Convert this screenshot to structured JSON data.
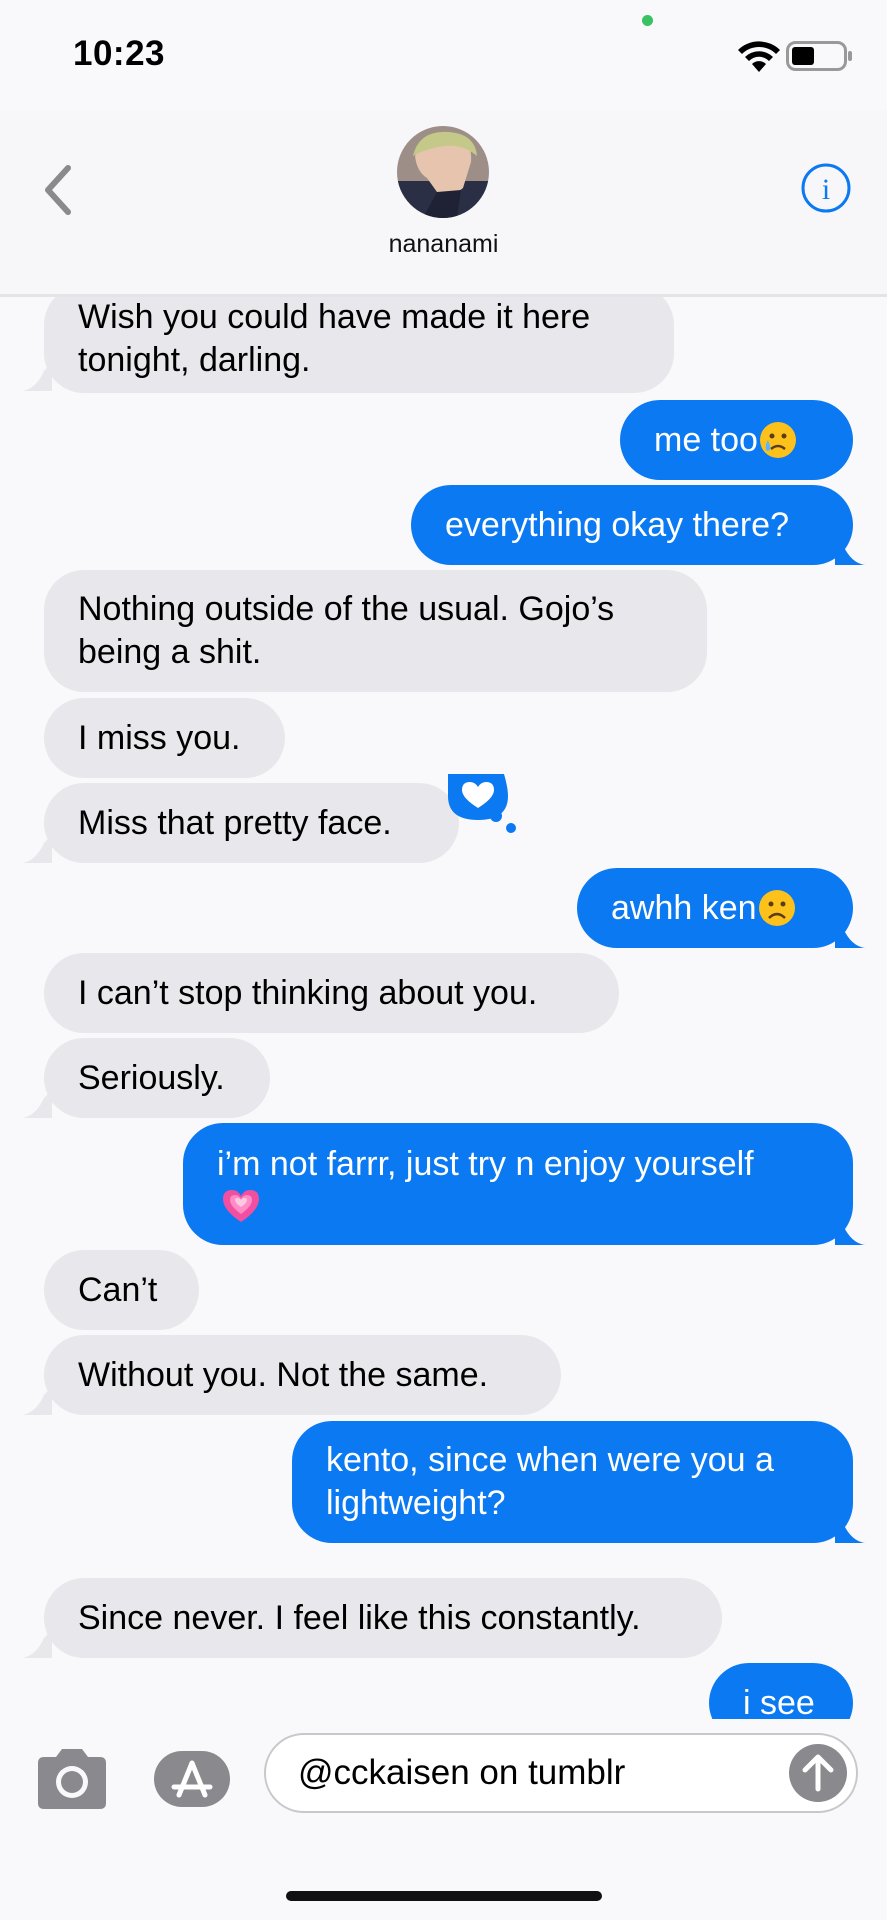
{
  "status_bar": {
    "time": "10:23"
  },
  "header": {
    "contact_name": "nananami"
  },
  "messages": [
    {
      "from": "them",
      "lines": [
        "Wish you could have made it here",
        "tonight, darling."
      ]
    },
    {
      "from": "me",
      "lines": [
        "me too"
      ],
      "emoji": "crying-face"
    },
    {
      "from": "me",
      "lines": [
        "everything okay there?"
      ]
    },
    {
      "from": "them",
      "lines": [
        "Nothing outside of the usual. Gojo’s",
        "being a shit."
      ]
    },
    {
      "from": "them",
      "lines": [
        "I miss you."
      ]
    },
    {
      "from": "them",
      "lines": [
        "Miss that pretty face."
      ],
      "tapback": "heart"
    },
    {
      "from": "me",
      "lines": [
        "awhh ken"
      ],
      "emoji": "frowning-face"
    },
    {
      "from": "them",
      "lines": [
        "I can’t stop thinking about you."
      ]
    },
    {
      "from": "them",
      "lines": [
        "Seriously."
      ]
    },
    {
      "from": "me",
      "lines": [
        "i’m not farrr, just try n enjoy yourself"
      ],
      "emoji": "growing-heart"
    },
    {
      "from": "them",
      "lines": [
        "Can’t"
      ]
    },
    {
      "from": "them",
      "lines": [
        "Without you. Not the same."
      ]
    },
    {
      "from": "me",
      "lines": [
        "kento, since when were you a",
        "lightweight?"
      ]
    },
    {
      "from": "them",
      "lines": [
        "Since never. I feel like this constantly."
      ]
    },
    {
      "from": "me",
      "lines": [
        "i see"
      ]
    }
  ],
  "composer": {
    "text": "@cckaisen on tumblr"
  },
  "colors": {
    "outgoing": "#0b79f2",
    "incoming": "#e8e8ec",
    "accent": "#0b79f2"
  }
}
